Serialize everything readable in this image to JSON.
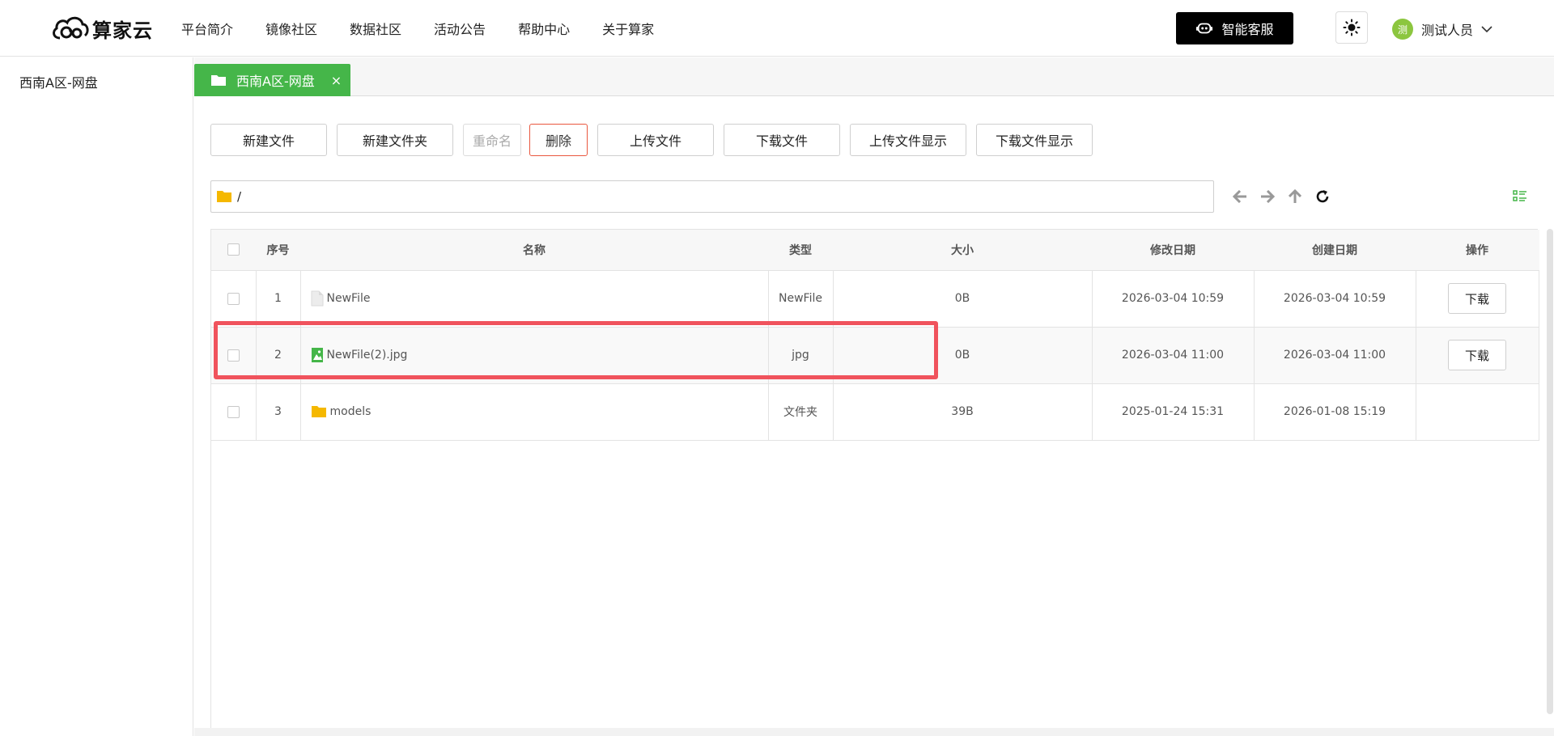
{
  "header": {
    "logo_text": "算家云",
    "nav": [
      "平台简介",
      "镜像社区",
      "数据社区",
      "活动公告",
      "帮助中心",
      "关于算家"
    ],
    "service_label": "智能客服",
    "user": {
      "avatar_text": "测",
      "name": "测试人员"
    }
  },
  "sidebar": {
    "items": [
      {
        "label": "西南A区-网盘"
      }
    ]
  },
  "tab": {
    "label": "西南A区-网盘",
    "close": "×"
  },
  "toolbar": {
    "buttons": [
      "新建文件",
      "新建文件夹",
      "重命名",
      "删除",
      "上传文件",
      "下载文件",
      "上传文件显示",
      "下载文件显示"
    ]
  },
  "path": {
    "value": "/"
  },
  "table": {
    "headers": [
      "序号",
      "名称",
      "类型",
      "大小",
      "修改日期",
      "创建日期",
      "操作"
    ],
    "rows": [
      {
        "index": "1",
        "name": "NewFile",
        "icon": "file-icon",
        "type": "NewFile",
        "size": "0B",
        "modified": "2026-03-04 10:59",
        "created": "2026-03-04 10:59",
        "action": "下载"
      },
      {
        "index": "2",
        "name": "NewFile(2).jpg",
        "icon": "image-file-icon",
        "type": "jpg",
        "size": "0B",
        "modified": "2026-03-04 11:00",
        "created": "2026-03-04 11:00",
        "action": "下载"
      },
      {
        "index": "3",
        "name": "models",
        "icon": "folder-icon",
        "type": "文件夹",
        "size": "39B",
        "modified": "2025-01-24 15:31",
        "created": "2026-01-08 15:19",
        "action": ""
      }
    ]
  },
  "colors": {
    "accent": "#45b649",
    "danger": "#e9573f",
    "highlight": "#f0535d",
    "folder": "#f5b800"
  }
}
